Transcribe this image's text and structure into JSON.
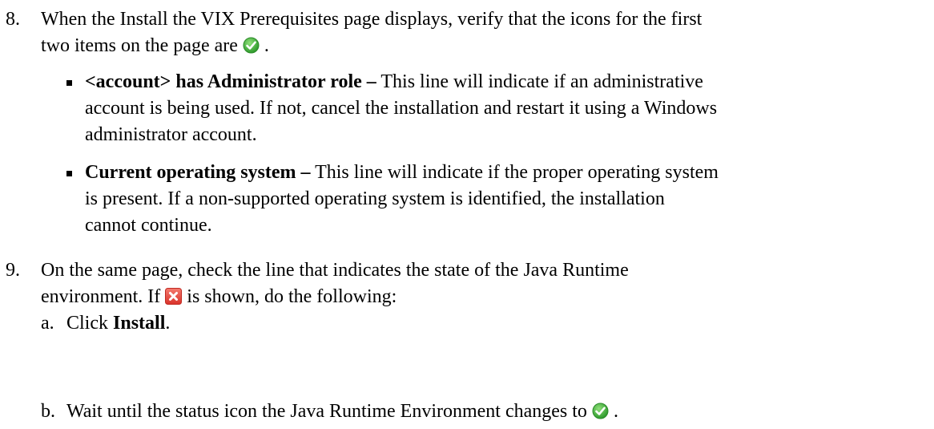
{
  "step8": {
    "number": "8.",
    "line1": "When the Install the VIX Prerequisites page displays, verify that the icons for the first",
    "line2_before": "two items on the page are",
    "line2_after": "."
  },
  "bullets": [
    {
      "bold": "<account> has Administrator role –",
      "line1_rest": " This line will indicate if an administrative",
      "line2": "account is being used. If not, cancel the installation and restart it using a Windows",
      "line3": "administrator account."
    },
    {
      "bold": "Current operating system –",
      "line1_rest": " This line will indicate if the proper operating system",
      "line2": "is present. If a non-supported operating system is identified, the installation",
      "line3": "cannot continue."
    }
  ],
  "step9": {
    "number": "9.",
    "line1": "On the same page, check the line that indicates the state of the Java Runtime",
    "line2_before": "environment. If",
    "line2_after": "is shown, do the following:"
  },
  "substeps": [
    {
      "label": "a.",
      "text_before": "Click ",
      "bold": "Install",
      "text_after": "."
    },
    {
      "label": "b.",
      "text_before": "Wait until the status icon the Java Runtime Environment changes to",
      "text_after": "."
    }
  ],
  "icons": {
    "check": "green-check-icon",
    "error": "red-x-icon"
  },
  "colors": {
    "check_green": "#3aa838",
    "error_red": "#e8453c"
  }
}
